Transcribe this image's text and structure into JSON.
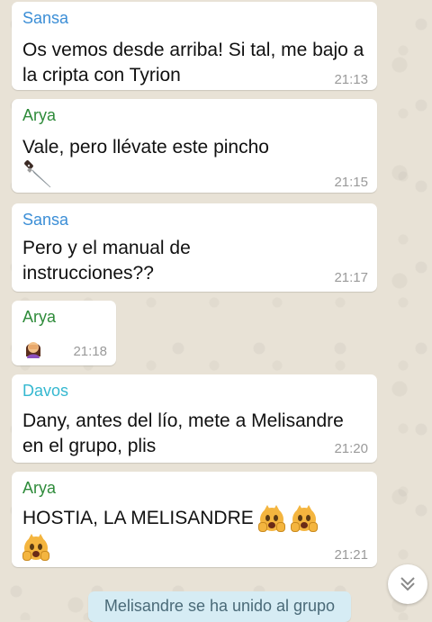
{
  "colors": {
    "wallpaper": "#e8e2d6",
    "bubble": "#ffffff",
    "sansa": "#3b8ed6",
    "arya": "#2e8b3a",
    "davos": "#35b8d0",
    "timestamp": "#9a9a9a",
    "system_bg": "#d6ecf4"
  },
  "messages": [
    {
      "sender": "Sansa",
      "text": "Os vemos desde arriba! Si tal, me bajo a\nla cripta con Tyrion",
      "time": "21:13"
    },
    {
      "sender": "Arya",
      "text": "Vale, pero llévate este pincho",
      "emoji": "dagger-emoji",
      "time": "21:15"
    },
    {
      "sender": "Sansa",
      "text": "Pero y el manual de\ninstrucciones??",
      "time": "21:17"
    },
    {
      "sender": "Arya",
      "emoji": "facepalm-woman-emoji",
      "time": "21:18"
    },
    {
      "sender": "Davos",
      "text": "Dany, antes del lío, mete a Melisandre\nen el grupo, plis",
      "time": "21:20"
    },
    {
      "sender": "Arya",
      "text": "HOSTIA, LA MELISANDRE",
      "emoji": "weary-cat-emoji",
      "time": "21:21"
    }
  ],
  "system_message": "Melisandre se ha unido al grupo",
  "scroll_button": {
    "icon": "double-chevron-down-icon"
  }
}
